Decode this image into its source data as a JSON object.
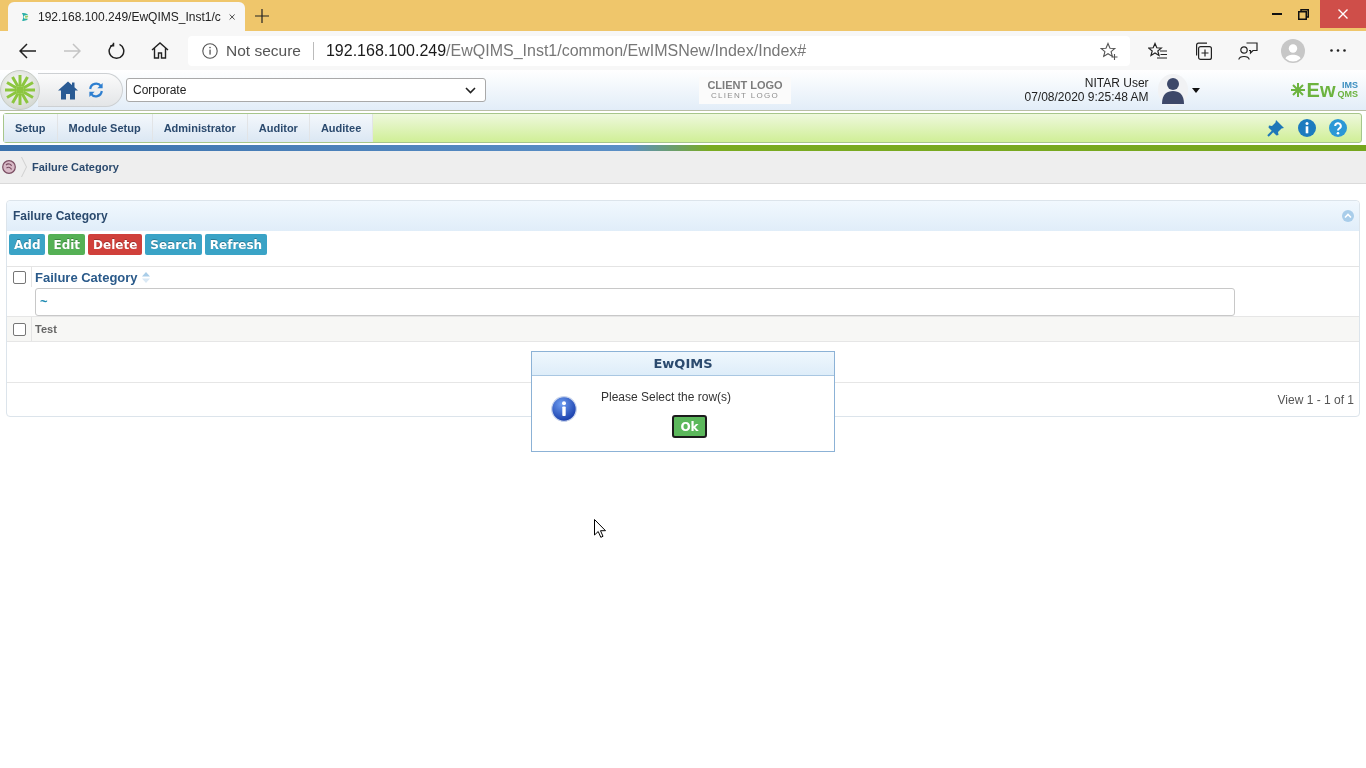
{
  "browser": {
    "tab": {
      "title": "192.168.100.249/EwQIMS_Inst1/c"
    },
    "nav": [
      {
        "kind": "back",
        "disabled": false
      },
      {
        "kind": "forward",
        "disabled": true
      },
      {
        "kind": "reload",
        "disabled": false
      },
      {
        "kind": "home",
        "disabled": false
      }
    ],
    "address": {
      "security": "Not secure",
      "host": "192.168.100.249",
      "path": "/EwQIMS_Inst1/common/EwIMSNew/Index/Index#"
    }
  },
  "header": {
    "location": "Corporate",
    "client_logo": {
      "title": "CLIENT LOGO",
      "subtitle": "CLIENT LOGO"
    },
    "user": {
      "name": "NITAR User",
      "datetime": "07/08/2020 9:25:48 AM"
    },
    "brand": {
      "name": "Ew",
      "top": "IMS",
      "bottom": "QMS"
    }
  },
  "menu": [
    {
      "label": "Setup",
      "selected": false
    },
    {
      "label": "Module Setup",
      "selected": false
    },
    {
      "label": "Administrator",
      "selected": false
    },
    {
      "label": "Auditor",
      "selected": false
    },
    {
      "label": "Auditee",
      "selected": false
    }
  ],
  "breadcrumb": {
    "title": "Failure Category"
  },
  "panel": {
    "title": "Failure Category",
    "expanded": true,
    "buttons": [
      {
        "label": "Add",
        "color": "#3aa3c6"
      },
      {
        "label": "Edit",
        "color": "#55b055"
      },
      {
        "label": "Delete",
        "color": "#d0403b"
      },
      {
        "label": "Search",
        "color": "#3aa3c6"
      },
      {
        "label": "Refresh",
        "color": "#3aa3c6"
      }
    ],
    "grid": {
      "columns": [
        {
          "label": "Failure Category"
        }
      ],
      "select_all": {
        "checked": false
      },
      "filter": {
        "value": "~"
      },
      "rows": [
        {
          "cells": [
            "Test"
          ],
          "checked": false
        }
      ],
      "pager": "View 1 - 1 of 1"
    }
  },
  "dialog": {
    "title": "EwQIMS",
    "message": "Please Select the row(s)",
    "buttons": [
      "Ok"
    ]
  }
}
